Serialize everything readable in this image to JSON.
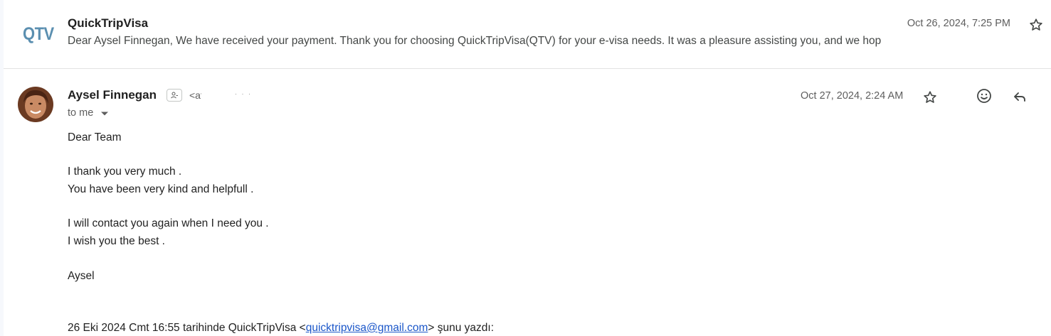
{
  "thread": {
    "messages": [
      {
        "sender": "QuickTripVisa",
        "logo_text": "QTV",
        "snippet": "Dear Aysel Finnegan, We have received your payment. Thank you for choosing QuickTripVisa(QTV) for your e-visa needs. It was a pleasure assisting you, and we hop",
        "date": "Oct 26, 2024, 7:25 PM",
        "starred": false
      },
      {
        "sender": "Aysel Finnegan",
        "email_partial": "<af",
        "recipient_label": "to me",
        "date": "Oct 27, 2024, 2:24 AM",
        "starred": false,
        "body": {
          "line1": "Dear Team",
          "line2": "I thank you very much .",
          "line3": "You have been very kind and helpfull .",
          "line4": "I will contact you again when I need you .",
          "line5": "I wish you the best .",
          "line6": "Aysel"
        },
        "quote": {
          "prefix": "26 Eki 2024 Cmt 16:55 tarihinde QuickTripVisa <",
          "link": "quicktripvisa@gmail.com",
          "suffix": "> şunu yazdı:"
        }
      }
    ]
  },
  "icons": {
    "star": "star-outline-icon",
    "emoji": "emoji-reaction-icon",
    "reply": "reply-icon",
    "contact": "contact-card-icon",
    "caret": "caret-down-icon"
  },
  "colors": {
    "logo": "#5b8fb0",
    "link": "#1a56c9",
    "muted": "#5e5e5e"
  }
}
